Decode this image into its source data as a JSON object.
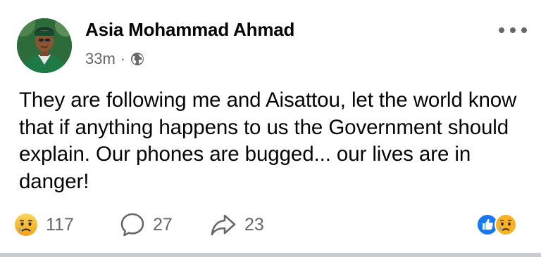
{
  "post": {
    "author": "Asia Mohammad Ahmad",
    "time": "33m",
    "separator": "·",
    "privacy_icon": "globe-icon",
    "more_icon": "ellipsis-icon",
    "text": "They are following me and Aisattou, let the world know that if anything happens to us the Government should explain. Our phones are bugged... our lives are in danger!"
  },
  "actions": {
    "reaction": {
      "icon": "sad-face-icon",
      "count": "117"
    },
    "comment": {
      "icon": "comment-bubble-icon",
      "count": "27"
    },
    "share": {
      "icon": "share-arrow-icon",
      "count": "23"
    }
  },
  "reaction_summary": [
    "like-icon",
    "sad-face-icon"
  ],
  "colors": {
    "text": "#050505",
    "secondary": "#65676b",
    "like_blue": "#1877f2",
    "emoji_yellow": "#f7b125"
  }
}
